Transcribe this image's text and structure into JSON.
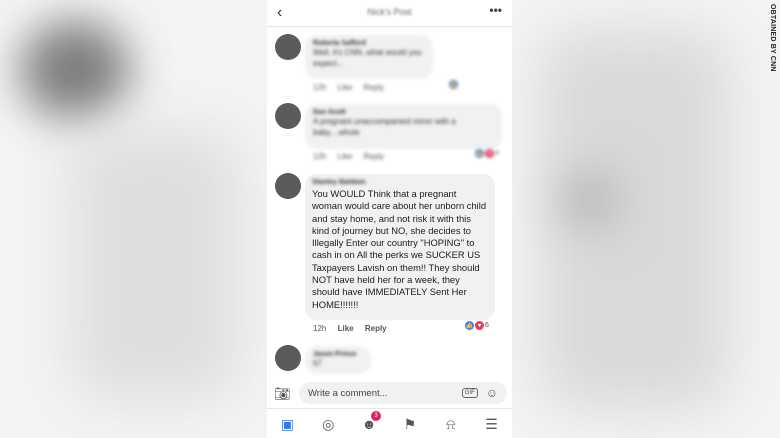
{
  "watermark": "OBTAINED BY CNN",
  "header": {
    "back_icon": "chevron-left-icon",
    "title": "Nick's Post",
    "more_icon": "ellipsis-icon"
  },
  "comments": [
    {
      "name": "Roberta Safford",
      "text": "Well, it's CNN..what would you expect...",
      "time": "12h",
      "like": "Like",
      "reply": "Reply",
      "reactions": ""
    },
    {
      "name": "Dan Scott",
      "text": "A pregnant unaccompanied minor with a baby....whole",
      "time": "12h",
      "like": "Like",
      "reply": "Reply",
      "reactions": "4"
    },
    {
      "name": "Stanley Baldwin",
      "text": "You WOULD Think that a pregnant woman would care about her unborn child and stay home, and not risk it with this kind of journey but NO, she decides to Illegally Enter our country \"HOPING\" to cash in on All the perks we SUCKER US Taxpayers Lavish on them!!  They should NOT have held her for a week, they should have IMMEDIATELY Sent Her HOME!!!!!!!",
      "time": "12h",
      "like": "Like",
      "reply": "Reply",
      "reactions": "6"
    },
    {
      "name": "Jason Prince",
      "text": "67"
    }
  ],
  "composer": {
    "placeholder": "Write a comment...",
    "gif": "GIF"
  },
  "tabs": [
    {
      "icon": "news-feed-icon",
      "active": true
    },
    {
      "icon": "profile-icon"
    },
    {
      "icon": "friends-icon",
      "badge": "3"
    },
    {
      "icon": "flag-icon"
    },
    {
      "icon": "bell-icon"
    },
    {
      "icon": "menu-icon"
    }
  ],
  "colors": {
    "accent": "#3578e5",
    "like": "#3b82f6",
    "love": "#e53e5a",
    "bubble": "#f0f1f3",
    "badge": "#e0245e"
  }
}
